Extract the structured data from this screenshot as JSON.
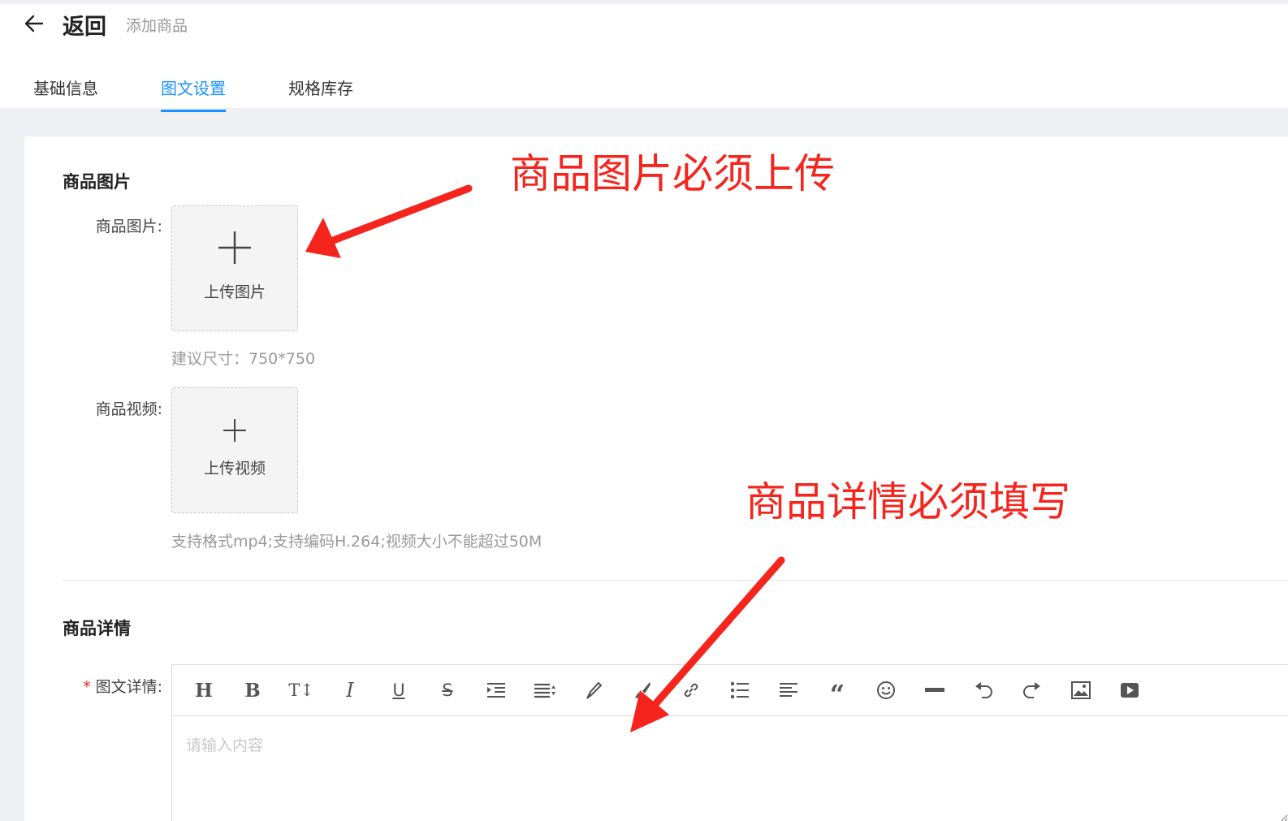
{
  "header": {
    "back_label": "返回",
    "page_subtitle": "添加商品"
  },
  "tabs": [
    {
      "label": "基础信息",
      "active": false
    },
    {
      "label": "图文设置",
      "active": true
    },
    {
      "label": "规格库存",
      "active": false
    }
  ],
  "images_section": {
    "title": "商品图片",
    "image_field": {
      "label": "商品图片:",
      "upload_text": "上传图片",
      "hint": "建议尺寸：750*750"
    },
    "video_field": {
      "label": "商品视频:",
      "upload_text": "上传视频",
      "hint": "支持格式mp4;支持编码H.264;视频大小不能超过50M"
    }
  },
  "detail_section": {
    "title": "商品详情",
    "field_label": "图文详情:",
    "required_mark": "*",
    "placeholder": "请输入内容",
    "toolbar": [
      "header-icon",
      "bold-icon",
      "font-size-icon",
      "italic-icon",
      "underline-icon",
      "strikethrough-icon",
      "indent-icon",
      "line-height-icon",
      "text-color-icon",
      "background-color-icon",
      "link-icon",
      "list-icon",
      "align-icon",
      "quote-icon",
      "emoji-icon",
      "divider-icon",
      "undo-icon",
      "redo-icon",
      "image-icon",
      "video-icon"
    ]
  },
  "annotations": {
    "image_note": "商品图片必须上传",
    "detail_note": "商品详情必须填写"
  },
  "colors": {
    "accent": "#1890ff",
    "annotation": "#f5241d",
    "required": "#f5222d"
  }
}
